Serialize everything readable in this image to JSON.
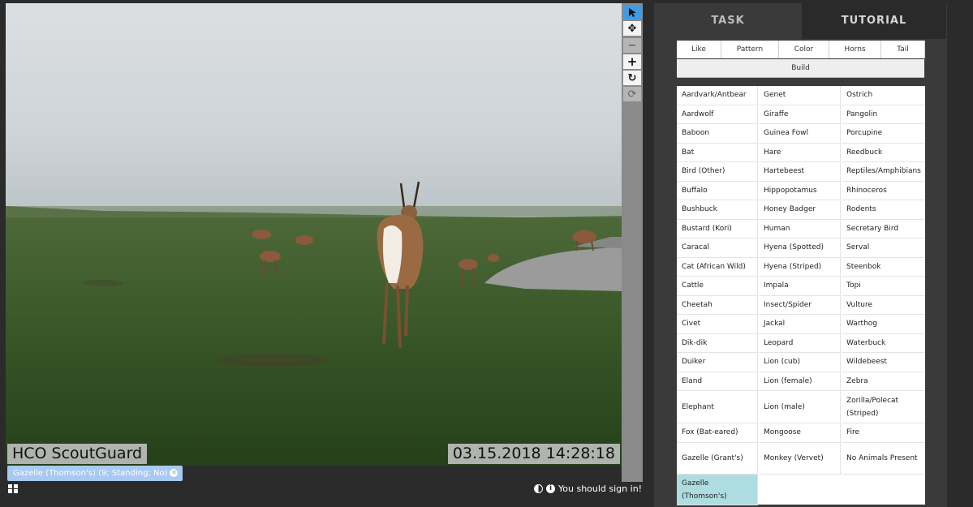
{
  "viewer": {
    "camera_label": "HCO ScoutGuard",
    "timestamp": "03.15.2018 14:28:18"
  },
  "toolbar": {
    "tools": [
      "pointer",
      "move",
      "zoom-out",
      "zoom-in",
      "rotate",
      "reset"
    ]
  },
  "annotation_chip": "Gazelle (Thomson's) (9; Standing; No)",
  "footer": {
    "sign_in": "You should sign in!"
  },
  "tabs": {
    "task": "TASK",
    "tutorial": "TUTORIAL"
  },
  "filters": {
    "row1": [
      "Like",
      "Pattern",
      "Color",
      "Horns",
      "Tail"
    ],
    "build": "Build"
  },
  "choices": {
    "col1": [
      "Aardvark/Antbear",
      "Aardwolf",
      "Baboon",
      "Bat",
      "Bird (Other)",
      "Buffalo",
      "Bushbuck",
      "Bustard (Kori)",
      "Caracal",
      "Cat (African Wild)",
      "Cattle",
      "Cheetah",
      "Civet",
      "Dik-dik",
      "Duiker",
      "Eland",
      "Elephant",
      "Fox (Bat-eared)",
      "Gazelle (Grant's)",
      "Gazelle (Thomson's)"
    ],
    "col2": [
      "Genet",
      "Giraffe",
      "Guinea Fowl",
      "Hare",
      "Hartebeest",
      "Hippopotamus",
      "Honey Badger",
      "Human",
      "Hyena (Spotted)",
      "Hyena (Striped)",
      "Impala",
      "Insect/Spider",
      "Jackal",
      "Leopard",
      "Lion (cub)",
      "Lion (female)",
      "Lion (male)",
      "Mongoose",
      "Monkey (Vervet)"
    ],
    "col3": [
      "Ostrich",
      "Pangolin",
      "Porcupine",
      "Reedbuck",
      "Reptiles/Amphibians",
      "Rhinoceros",
      "Rodents",
      "Secretary Bird",
      "Serval",
      "Steenbok",
      "Topi",
      "Vulture",
      "Warthog",
      "Waterbuck",
      "Wildebeest",
      "Zebra",
      "Zorilla/Polecat (Striped)",
      "Fire",
      "No Animals Present"
    ],
    "selected": "Gazelle (Thomson's)"
  },
  "colors": {
    "accent": "#3f9be4",
    "selected_bg": "#aedde1",
    "chip_bg": "#a7c9f2"
  }
}
